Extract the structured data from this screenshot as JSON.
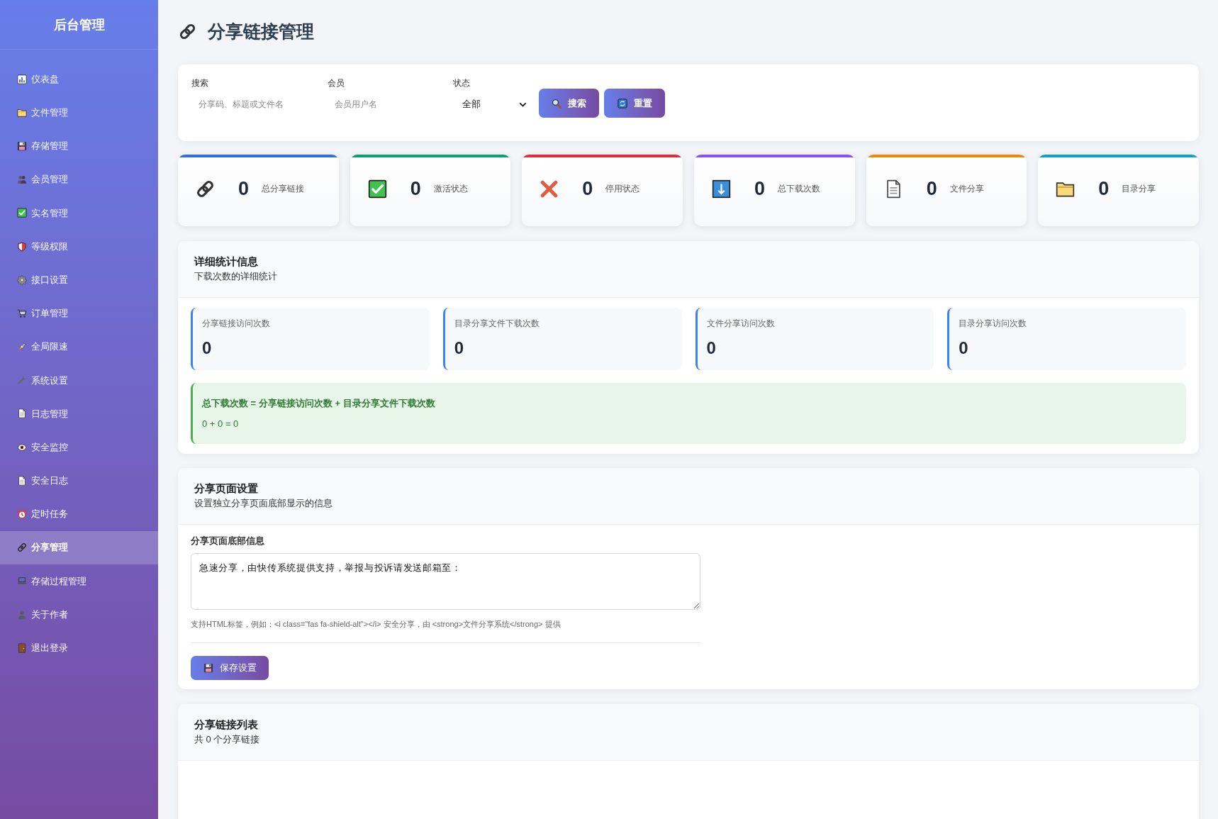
{
  "sidebar": {
    "title": "后台管理",
    "items": [
      {
        "label": "仪表盘",
        "selected": false
      },
      {
        "label": "文件管理",
        "selected": false
      },
      {
        "label": "存储管理",
        "selected": false
      },
      {
        "label": "会员管理",
        "selected": false
      },
      {
        "label": "实名管理",
        "selected": false
      },
      {
        "label": "等级权限",
        "selected": false
      },
      {
        "label": "接口设置",
        "selected": false
      },
      {
        "label": "订单管理",
        "selected": false
      },
      {
        "label": "全局限速",
        "selected": false
      },
      {
        "label": "系统设置",
        "selected": false
      },
      {
        "label": "日志管理",
        "selected": false
      },
      {
        "label": "安全监控",
        "selected": false
      },
      {
        "label": "安全日志",
        "selected": false
      },
      {
        "label": "定时任务",
        "selected": false
      },
      {
        "label": "分享管理",
        "selected": true
      },
      {
        "label": "存储过程管理",
        "selected": false
      },
      {
        "label": "关于作者",
        "selected": false
      },
      {
        "label": "退出登录",
        "selected": false
      }
    ]
  },
  "page_title": "分享链接管理",
  "search": {
    "fields": [
      {
        "label": "搜索",
        "placeholder": "分享码、标题或文件名"
      },
      {
        "label": "会员",
        "placeholder": "会员用户名"
      }
    ],
    "status_filter": {
      "label": "状态",
      "value": "全部"
    },
    "buttons": [
      "搜索",
      "重置"
    ]
  },
  "stats": [
    {
      "value": "0",
      "label": "总分享链接",
      "color": "#2f6fde"
    },
    {
      "value": "0",
      "label": "激活状态",
      "color": "#0f9f6e"
    },
    {
      "value": "0",
      "label": "停用状态",
      "color": "#e02d3c"
    },
    {
      "value": "0",
      "label": "总下载次数",
      "color": "#8a4ff0"
    },
    {
      "value": "0",
      "label": "文件分享",
      "color": "#e8890c"
    },
    {
      "value": "0",
      "label": "目录分享",
      "color": "#0ea2c7"
    }
  ],
  "detail_stats": {
    "title": "详细统计信息",
    "subtitle": "下载次数的详细统计",
    "metrics": [
      {
        "label": "分享链接访问次数",
        "value": "0"
      },
      {
        "label": "目录分享文件下载次数",
        "value": "0"
      },
      {
        "label": "文件分享访问次数",
        "value": "0"
      },
      {
        "label": "目录分享访问次数",
        "value": "0"
      }
    ],
    "formula": {
      "text": "总下载次数 = 分享链接访问次数 + 目录分享文件下载次数",
      "result": "0 + 0 = 0"
    }
  },
  "share_page_settings": {
    "title": "分享页面设置",
    "subtitle": "设置独立分享页面底部显示的信息",
    "field_label": "分享页面底部信息",
    "value": "急速分享，由快传系统提供支持，举报与投诉请发送邮箱至：",
    "hint": "支持HTML标签，例如：<i class=\"fas fa-shield-alt\"></i> 安全分享，由 <strong>文件分享系统</strong> 提供",
    "save_button": "保存设置"
  },
  "share_list": {
    "title": "分享链接列表",
    "subtitle": "共 0 个分享链接"
  }
}
